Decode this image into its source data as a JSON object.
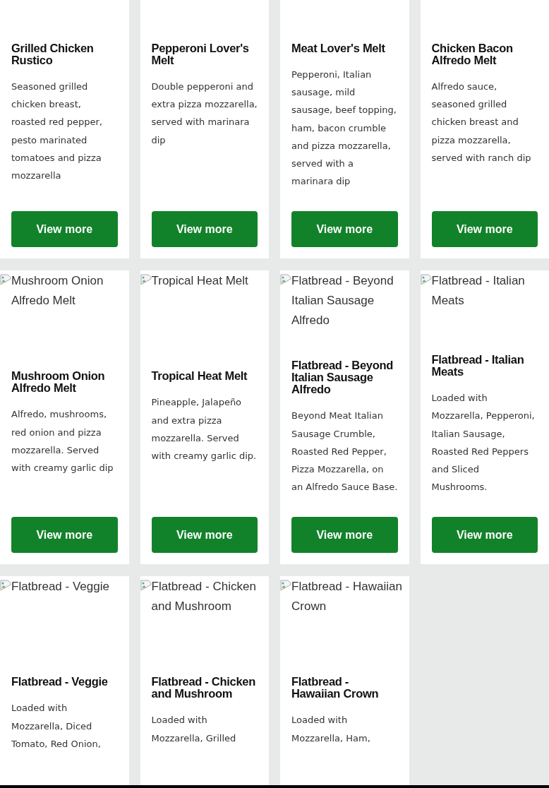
{
  "cards": [
    {
      "title": "Grilled Chicken Rustico",
      "description": "Seasoned grilled chicken breast, roasted red pepper, pesto marinated tomatoes and pizza mozzarella",
      "button": "View more"
    },
    {
      "title": "Pepperoni Lover's Melt",
      "description": "Double pepperoni and extra pizza mozzarella, served with marinara dip",
      "button": "View more"
    },
    {
      "title": "Meat Lover's Melt",
      "description": "Pepperoni, Italian sausage, mild sausage, beef topping, ham, bacon crumble and pizza mozzarella, served with a marinara dip",
      "button": "View more"
    },
    {
      "title": "Chicken Bacon Alfredo Melt",
      "description": "Alfredo sauce, seasoned grilled chicken breast and pizza mozzarella, served with ranch dip",
      "button": "View more"
    },
    {
      "image_alt": "Mushroom Onion Alfredo Melt",
      "title": "Mushroom Onion Alfredo Melt",
      "description": "Alfredo, mushrooms, red onion and pizza mozzarella. Served with creamy garlic dip",
      "button": "View more"
    },
    {
      "image_alt": "Tropical Heat Melt",
      "title": "Tropical Heat Melt",
      "description": "Pineapple, Jalapeño and extra pizza mozzarella. Served with creamy garlic dip.",
      "button": "View more"
    },
    {
      "image_alt": "Flatbread - Beyond Italian Sausage Alfredo",
      "title": "Flatbread - Beyond Italian Sausage Alfredo",
      "description": "Beyond Meat Italian Sausage Crumble, Roasted Red Pepper, Pizza Mozzarella, on an Alfredo Sauce Base.",
      "button": "View more"
    },
    {
      "image_alt": "Flatbread - Italian Meats",
      "title": "Flatbread - Italian Meats",
      "description": "Loaded with Mozzarella, Pepperoni, Italian Sausage, Roasted Red Peppers and Sliced Mushrooms.",
      "button": "View more"
    },
    {
      "image_alt": "Flatbread - Veggie",
      "title": "Flatbread - Veggie",
      "description": "Loaded with Mozzarella, Diced Tomato, Red Onion,"
    },
    {
      "image_alt": "Flatbread - Chicken and Mushroom",
      "title": "Flatbread - Chicken and Mushroom",
      "description": "Loaded with Mozzarella, Grilled"
    },
    {
      "image_alt": "Flatbread - Hawaiian Crown",
      "title": "Flatbread - Hawaiian Crown",
      "description": "Loaded with Mozzarella, Ham,"
    }
  ]
}
